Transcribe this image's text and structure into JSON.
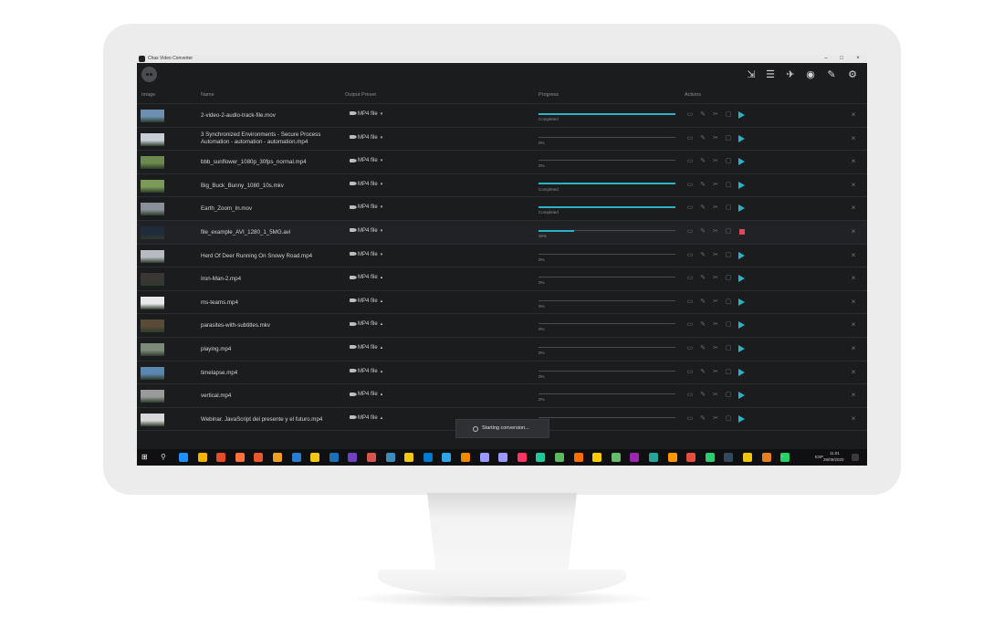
{
  "window": {
    "title": "Chas Video Converter",
    "controls": [
      "–",
      "□",
      "×"
    ]
  },
  "header_icons": [
    "add-file-icon",
    "settings-sliders-icon",
    "convert-icon",
    "preview-eye-icon",
    "brush-icon",
    "gear-icon"
  ],
  "columns": {
    "image": "Image",
    "name": "Name",
    "output_preset": "Output Preset",
    "progress": "Progress",
    "actions": "Actions"
  },
  "rows": [
    {
      "name": "2-video-2-audio-track-file.mov",
      "preset": "MP4 file",
      "progress_label": "Completed",
      "progress": 1.0,
      "state": "ready",
      "thumb_color": "#6d8fb0"
    },
    {
      "name": "3 Synchronized Environments - Secure Process Automation - automation - automation.mp4",
      "preset": "MP4 file",
      "progress_label": "0%",
      "progress": 0,
      "state": "ready",
      "thumb_color": "#c9ced6"
    },
    {
      "name": "bbb_sunflower_1080p_30fps_normal.mp4",
      "preset": "MP4 file",
      "progress_label": "0%",
      "progress": 0,
      "state": "ready",
      "thumb_color": "#6c8a4e"
    },
    {
      "name": "Big_Buck_Bunny_1080_10s.mkv",
      "preset": "MP4 file",
      "progress_label": "Completed",
      "progress": 1.0,
      "state": "ready",
      "thumb_color": "#7a9a58"
    },
    {
      "name": "Earth_Zoom_In.mov",
      "preset": "MP4 file",
      "progress_label": "Completed",
      "progress": 1.0,
      "state": "ready",
      "thumb_color": "#8a9098"
    },
    {
      "name": "file_example_AVI_1280_1_5MG.avi",
      "preset": "MP4 file",
      "progress_label": "26%",
      "progress": 0.26,
      "state": "converting",
      "thumb_color": "#1f2a3a"
    },
    {
      "name": "Herd Of Deer Running On Snowy Road.mp4",
      "preset": "MP4 file",
      "progress_label": "0%",
      "progress": 0,
      "state": "ready",
      "thumb_color": "#b8bcc2"
    },
    {
      "name": "Iron-Man-2.mp4",
      "preset": "MP4 file",
      "progress_label": "0%",
      "progress": 0,
      "state": "ready",
      "thumb_color": "#3a3636"
    },
    {
      "name": "ms-teams.mp4",
      "preset": "MP4 file",
      "progress_label": "0%",
      "progress": 0,
      "state": "ready",
      "thumb_color": "#e8e8ec"
    },
    {
      "name": "parasites-with-subtitles.mkv",
      "preset": "MP4 file",
      "progress_label": "0%",
      "progress": 0,
      "state": "ready",
      "thumb_color": "#5a4a3a"
    },
    {
      "name": "playing.mp4",
      "preset": "MP4 file",
      "progress_label": "0%",
      "progress": 0,
      "state": "ready",
      "thumb_color": "#7c8a78"
    },
    {
      "name": "timelapse.mp4",
      "preset": "MP4 file",
      "progress_label": "0%",
      "progress": 0,
      "state": "ready",
      "thumb_color": "#5b86b0"
    },
    {
      "name": "vertical.mp4",
      "preset": "MP4 file",
      "progress_label": "0%",
      "progress": 0,
      "state": "ready",
      "thumb_color": "#9a9a9a"
    },
    {
      "name": "Webinar. JavaScript del presente y el futuro.mp4",
      "preset": "MP4 file",
      "progress_label": "",
      "progress": 0,
      "state": "ready",
      "thumb_color": "#d8d8d8"
    }
  ],
  "toast": {
    "message": "Starting conversion..."
  },
  "taskbar": {
    "time": "11:01",
    "date": "28/09/2020",
    "lang": "ESP",
    "app_colors": [
      "#1e90ff",
      "#f4b400",
      "#e34c26",
      "#ff7139",
      "#e8562a",
      "#f0a020",
      "#2b7bd3",
      "#f2c811",
      "#1d6fb8",
      "#6f42c1",
      "#d9534f",
      "#3c8dbc",
      "#f2c811",
      "#007acc",
      "#2fa4e7",
      "#f28a00",
      "#9999ff",
      "#9999ff",
      "#ff3366",
      "#20c997",
      "#5cb85c",
      "#ff6f00",
      "#ffcc00",
      "#66bb6a",
      "#9c27b0",
      "#26a69a",
      "#ff9800",
      "#e74c3c",
      "#2ecc71",
      "#34495e",
      "#f1c40f",
      "#e67e22",
      "#25d366"
    ]
  }
}
